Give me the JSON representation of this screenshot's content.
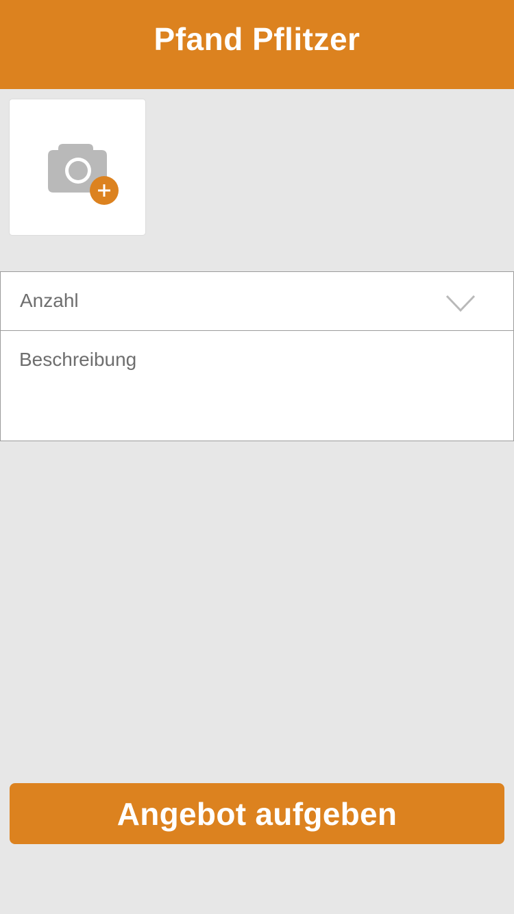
{
  "header": {
    "title": "Pfand Pflitzer"
  },
  "photo_upload": {
    "icon": "camera-add-icon"
  },
  "form": {
    "quantity_label": "Anzahl",
    "quantity_icon": "chevron-down-icon",
    "description_placeholder": "Beschreibung"
  },
  "submit": {
    "label": "Angebot aufgeben"
  },
  "colors": {
    "brand": "#dc821f",
    "background": "#e7e7e7",
    "icon_gray": "#b9b9b9"
  }
}
